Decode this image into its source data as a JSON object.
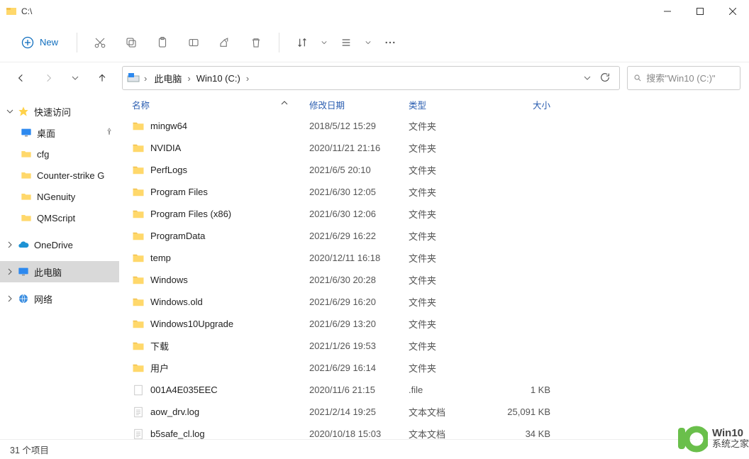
{
  "window": {
    "title": "C:\\"
  },
  "toolbar": {
    "new_label": "New"
  },
  "breadcrumb": {
    "item0": "此电脑",
    "item1": "Win10 (C:)"
  },
  "search": {
    "placeholder": "搜索\"Win10 (C:)\""
  },
  "columns": {
    "name": "名称",
    "date": "修改日期",
    "type": "类型",
    "size": "大小"
  },
  "sidebar": {
    "quick_access": "快速访问",
    "desktop": "桌面",
    "cfg": "cfg",
    "cs": "Counter-strike  G",
    "ngenuity": "NGenuity",
    "qmscript": "QMScript",
    "onedrive": "OneDrive",
    "this_pc": "此电脑",
    "network": "网络"
  },
  "rows": [
    {
      "name": "mingw64",
      "date": "2018/5/12 15:29",
      "type": "文件夹",
      "size": "",
      "icon": "folder"
    },
    {
      "name": "NVIDIA",
      "date": "2020/11/21 21:16",
      "type": "文件夹",
      "size": "",
      "icon": "folder"
    },
    {
      "name": "PerfLogs",
      "date": "2021/6/5 20:10",
      "type": "文件夹",
      "size": "",
      "icon": "folder"
    },
    {
      "name": "Program Files",
      "date": "2021/6/30 12:05",
      "type": "文件夹",
      "size": "",
      "icon": "folder"
    },
    {
      "name": "Program Files (x86)",
      "date": "2021/6/30 12:06",
      "type": "文件夹",
      "size": "",
      "icon": "folder"
    },
    {
      "name": "ProgramData",
      "date": "2021/6/29 16:22",
      "type": "文件夹",
      "size": "",
      "icon": "folder"
    },
    {
      "name": "temp",
      "date": "2020/12/11 16:18",
      "type": "文件夹",
      "size": "",
      "icon": "folder"
    },
    {
      "name": "Windows",
      "date": "2021/6/30 20:28",
      "type": "文件夹",
      "size": "",
      "icon": "folder"
    },
    {
      "name": "Windows.old",
      "date": "2021/6/29 16:20",
      "type": "文件夹",
      "size": "",
      "icon": "folder"
    },
    {
      "name": "Windows10Upgrade",
      "date": "2021/6/29 13:20",
      "type": "文件夹",
      "size": "",
      "icon": "folder"
    },
    {
      "name": "下载",
      "date": "2021/1/26 19:53",
      "type": "文件夹",
      "size": "",
      "icon": "folder"
    },
    {
      "name": "用户",
      "date": "2021/6/29 16:14",
      "type": "文件夹",
      "size": "",
      "icon": "folder"
    },
    {
      "name": "001A4E035EEC",
      "date": "2020/11/6 21:15",
      "type": ".file",
      "size": "1 KB",
      "icon": "file"
    },
    {
      "name": "aow_drv.log",
      "date": "2021/2/14 19:25",
      "type": "文本文档",
      "size": "25,091 KB",
      "icon": "txt"
    },
    {
      "name": "b5safe_cl.log",
      "date": "2020/10/18 15:03",
      "type": "文本文档",
      "size": "34 KB",
      "icon": "txt"
    }
  ],
  "status": {
    "items": "31 个项目"
  },
  "watermark": {
    "line1": "Win10",
    "line2": "系统之家"
  }
}
